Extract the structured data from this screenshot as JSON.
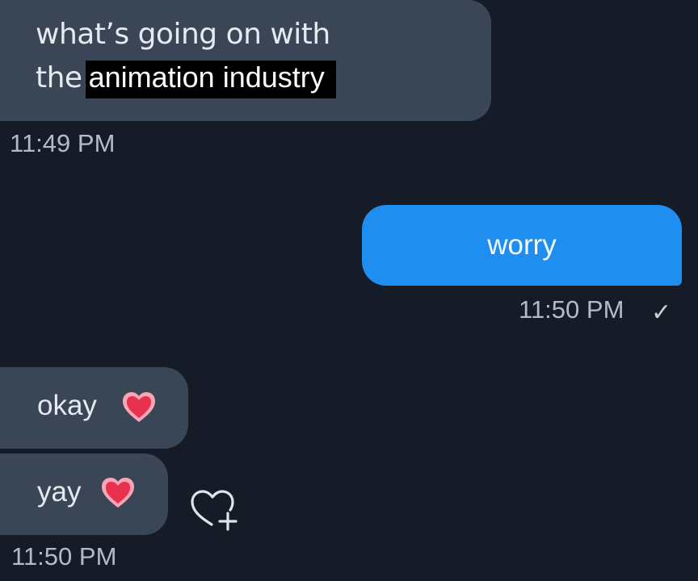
{
  "messages": [
    {
      "direction": "incoming",
      "line1": "what’s going on with",
      "line2_prefix": "the",
      "line2_highlight": "animation industry"
    },
    {
      "direction": "outgoing",
      "text": "worry"
    },
    {
      "direction": "incoming",
      "text": "okay",
      "emoji": "red-heart"
    },
    {
      "direction": "incoming",
      "text": "yay",
      "emoji": "red-heart"
    }
  ],
  "timestamps": {
    "first": "11:49 PM",
    "second": "11:50 PM",
    "third": "11:50 PM"
  },
  "status": {
    "read_mark": "✓"
  },
  "icons": {
    "react": "add-reaction-heart-icon",
    "emoji": "red-heart-icon"
  },
  "colors": {
    "background": "#151c28",
    "incoming_bubble": "#3a4555",
    "outgoing_bubble": "#1e8ef0",
    "timestamp": "#b3bbc7"
  }
}
